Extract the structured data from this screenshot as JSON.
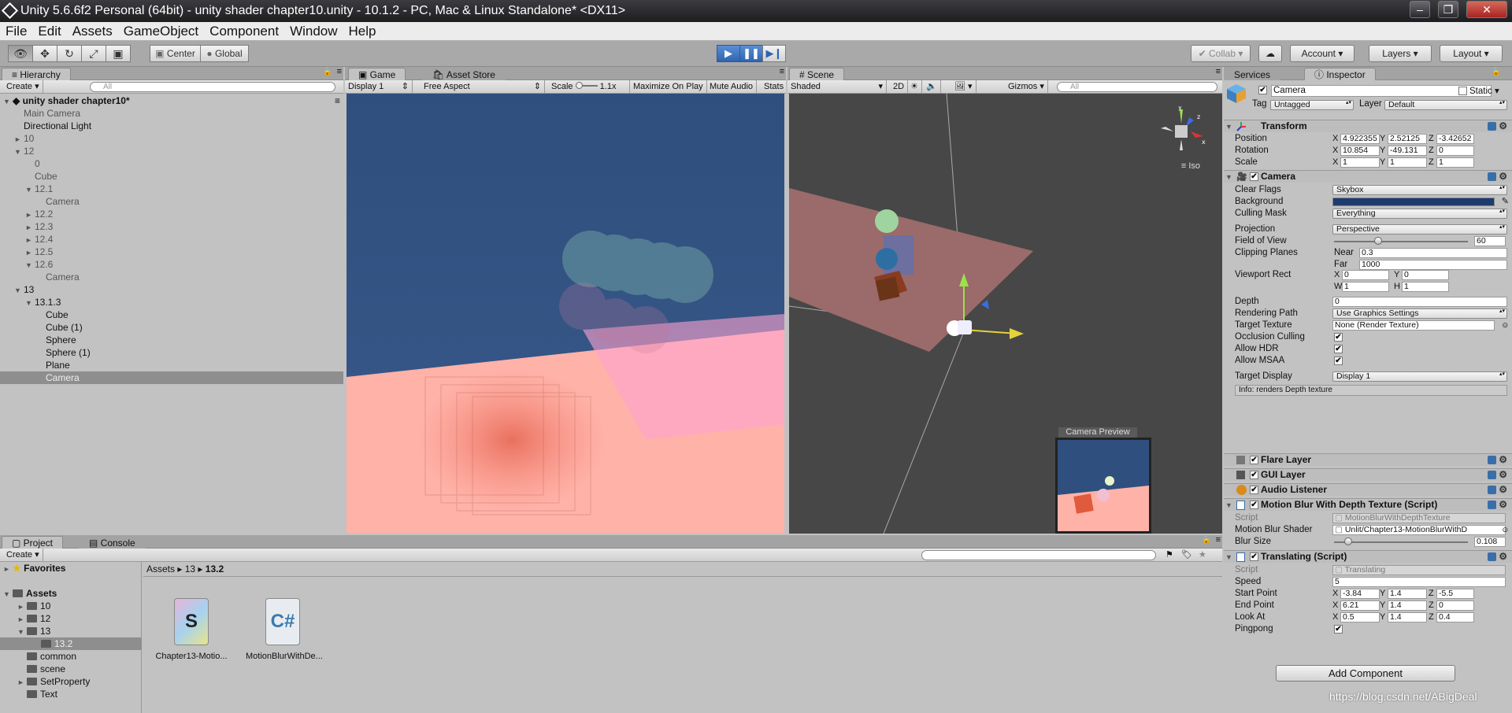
{
  "window": {
    "title": "Unity 5.6.6f2 Personal (64bit) - unity shader chapter10.unity - 10.1.2 - PC, Mac & Linux Standalone* <DX11>"
  },
  "menu": [
    "File",
    "Edit",
    "Assets",
    "GameObject",
    "Component",
    "Window",
    "Help"
  ],
  "toolbar": {
    "center": "Center",
    "global": "Global",
    "collab": "Collab",
    "account": "Account",
    "layers": "Layers",
    "layout": "Layout"
  },
  "hierarchy": {
    "tab": "Hierarchy",
    "create": "Create",
    "search_placeholder": "All",
    "scene": "unity shader chapter10*",
    "items": [
      {
        "label": "Main Camera",
        "indent": 0,
        "arrow": "",
        "muted": true
      },
      {
        "label": "Directional Light",
        "indent": 0,
        "arrow": ""
      },
      {
        "label": "10",
        "indent": 0,
        "arrow": "►",
        "muted": true
      },
      {
        "label": "12",
        "indent": 0,
        "arrow": "▼",
        "muted": true
      },
      {
        "label": "0",
        "indent": 1,
        "arrow": "",
        "muted": true
      },
      {
        "label": "Cube",
        "indent": 1,
        "arrow": "",
        "muted": true
      },
      {
        "label": "12.1",
        "indent": 1,
        "arrow": "▼",
        "muted": true
      },
      {
        "label": "Camera",
        "indent": 2,
        "arrow": "",
        "muted": true
      },
      {
        "label": "12.2",
        "indent": 1,
        "arrow": "►",
        "muted": true
      },
      {
        "label": "12.3",
        "indent": 1,
        "arrow": "►",
        "muted": true
      },
      {
        "label": "12.4",
        "indent": 1,
        "arrow": "►",
        "muted": true
      },
      {
        "label": "12.5",
        "indent": 1,
        "arrow": "►",
        "muted": true
      },
      {
        "label": "12.6",
        "indent": 1,
        "arrow": "▼",
        "muted": true
      },
      {
        "label": "Camera",
        "indent": 2,
        "arrow": "",
        "muted": true
      },
      {
        "label": "13",
        "indent": 0,
        "arrow": "▼"
      },
      {
        "label": "13.1.3",
        "indent": 1,
        "arrow": "▼"
      },
      {
        "label": "Cube",
        "indent": 2,
        "arrow": ""
      },
      {
        "label": "Cube (1)",
        "indent": 2,
        "arrow": ""
      },
      {
        "label": "Sphere",
        "indent": 2,
        "arrow": ""
      },
      {
        "label": "Sphere (1)",
        "indent": 2,
        "arrow": ""
      },
      {
        "label": "Plane",
        "indent": 2,
        "arrow": ""
      },
      {
        "label": "Camera",
        "indent": 2,
        "arrow": "",
        "selected": true
      }
    ]
  },
  "game": {
    "tab": "Game",
    "asset_store": "Asset Store",
    "display": "Display 1",
    "aspect": "Free Aspect",
    "scale_label": "Scale",
    "scale_value": "1.1x",
    "maximize": "Maximize On Play",
    "mute": "Mute Audio",
    "stats": "Stats"
  },
  "scene": {
    "tab": "Scene",
    "shading": "Shaded",
    "mode2d": "2D",
    "gizmos": "Gizmos",
    "search_placeholder": "All",
    "iso": "Iso",
    "camera_preview": "Camera Preview"
  },
  "project": {
    "tab": "Project",
    "console": "Console",
    "create": "Create",
    "favorites": "Favorites",
    "tree": [
      {
        "label": "Assets",
        "indent": 0,
        "arrow": "▼",
        "bold": true
      },
      {
        "label": "10",
        "indent": 1,
        "arrow": "►"
      },
      {
        "label": "12",
        "indent": 1,
        "arrow": "►"
      },
      {
        "label": "13",
        "indent": 1,
        "arrow": "▼"
      },
      {
        "label": "13.2",
        "indent": 2,
        "arrow": "",
        "selected": true
      },
      {
        "label": "common",
        "indent": 1,
        "arrow": ""
      },
      {
        "label": "scene",
        "indent": 1,
        "arrow": ""
      },
      {
        "label": "SetProperty",
        "indent": 1,
        "arrow": "►"
      },
      {
        "label": "Text",
        "indent": 1,
        "arrow": ""
      }
    ],
    "breadcrumb": [
      "Assets",
      "13",
      "13.2"
    ],
    "files": [
      {
        "name": "Chapter13-Motio...",
        "kind": "shader",
        "glyph": "S"
      },
      {
        "name": "MotionBlurWithDe...",
        "kind": "script",
        "glyph": "C#"
      }
    ]
  },
  "inspector": {
    "tabs": [
      "Services",
      "Inspector"
    ],
    "object_name": "Camera",
    "static": "Static",
    "tag_label": "Tag",
    "tag": "Untagged",
    "layer_label": "Layer",
    "layer": "Default",
    "transform": {
      "title": "Transform",
      "position_label": "Position",
      "rotation_label": "Rotation",
      "scale_label": "Scale",
      "position": [
        "4.922355",
        "2.52125",
        "-3.42652"
      ],
      "rotation": [
        "10.854",
        "-49.131",
        "0"
      ],
      "scale": [
        "1",
        "1",
        "1"
      ]
    },
    "camera": {
      "title": "Camera",
      "clear_flags_label": "Clear Flags",
      "clear_flags": "Skybox",
      "background_label": "Background",
      "background_color": "#1f3a6e",
      "culling_label": "Culling Mask",
      "culling": "Everything",
      "projection_label": "Projection",
      "projection": "Perspective",
      "fov_label": "Field of View",
      "fov": "60",
      "fov_fraction": 0.33,
      "clipping_label": "Clipping Planes",
      "near_label": "Near",
      "near": "0.3",
      "far_label": "Far",
      "far": "1000",
      "viewport_label": "Viewport Rect",
      "vx": "0",
      "vy": "0",
      "vw": "1",
      "vh": "1",
      "depth_label": "Depth",
      "depth": "0",
      "rendering_label": "Rendering Path",
      "rendering": "Use Graphics Settings",
      "target_label": "Target Texture",
      "target": "None (Render Texture)",
      "occlusion_label": "Occlusion Culling",
      "hdr_label": "Allow HDR",
      "msaa_label": "Allow MSAA",
      "display_label": "Target Display",
      "display": "Display 1",
      "info": "Info: renders Depth texture"
    },
    "flare": "Flare Layer",
    "gui": "GUI Layer",
    "audio": "Audio Listener",
    "motion": {
      "title": "Motion Blur With Depth Texture (Script)",
      "script_label": "Script",
      "script": "MotionBlurWithDepthTexture",
      "shader_label": "Motion Blur Shader",
      "shader": "Unlit/Chapter13-MotionBlurWithD",
      "blur_label": "Blur Size",
      "blur": "0.108",
      "blur_fraction": 0.108
    },
    "translating": {
      "title": "Translating (Script)",
      "script_label": "Script",
      "script": "Translating",
      "speed_label": "Speed",
      "speed": "5",
      "start_label": "Start Point",
      "start": [
        "-3.84",
        "1.4",
        "-5.5"
      ],
      "end_label": "End Point",
      "end": [
        "6.21",
        "1.4",
        "0"
      ],
      "look_label": "Look At",
      "look": [
        "0.5",
        "1.4",
        "0.4"
      ],
      "ping_label": "Pingpong"
    },
    "add_component": "Add Component"
  },
  "axes": {
    "x": "X",
    "y": "Y",
    "z": "Z",
    "w": "W",
    "h": "H"
  },
  "watermark": "https://blog.csdn.net/ABigDeal"
}
